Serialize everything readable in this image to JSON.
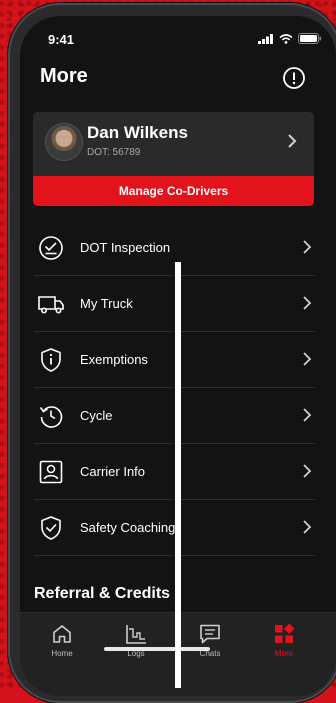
{
  "status": {
    "time": "9:41"
  },
  "header": {
    "title": "More"
  },
  "profile": {
    "name": "Dan Wilkens",
    "dot": "DOT: 56789",
    "manage_label": "Manage Co-Drivers"
  },
  "menu": [
    {
      "label": "DOT Inspection",
      "icon": "dot-inspection-icon"
    },
    {
      "label": "My Truck",
      "icon": "truck-icon"
    },
    {
      "label": "Exemptions",
      "icon": "shield-info-icon"
    },
    {
      "label": "Cycle",
      "icon": "cycle-history-icon"
    },
    {
      "label": "Carrier Info",
      "icon": "carrier-id-icon"
    },
    {
      "label": "Safety Coaching",
      "icon": "shield-check-icon"
    }
  ],
  "section": {
    "title": "Referral & Credits"
  },
  "tabs": [
    {
      "label": "Home",
      "icon": "home-icon"
    },
    {
      "label": "Logs",
      "icon": "logs-icon"
    },
    {
      "label": "Chats",
      "icon": "chats-icon"
    },
    {
      "label": "More",
      "icon": "more-grid-icon"
    }
  ],
  "colors": {
    "accent": "#e3131c",
    "background": "#131313",
    "card": "#2a2a2a"
  }
}
